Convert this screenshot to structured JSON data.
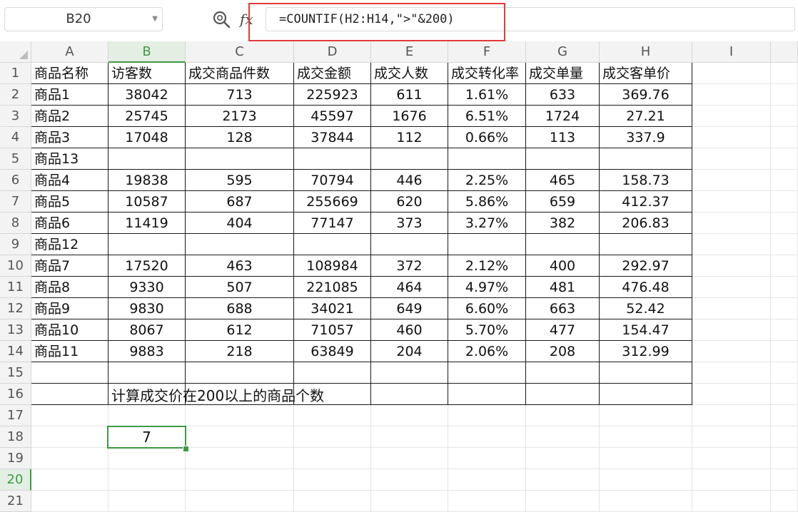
{
  "formula_bar": {
    "name_box": "B20",
    "formula": "=COUNTIF(H2:H14,\">\"&200)",
    "zoom_icon": "zoom-search-icon",
    "fx_icon_label": "fx"
  },
  "sheet": {
    "columns": [
      "A",
      "B",
      "C",
      "D",
      "E",
      "F",
      "G",
      "H",
      "I"
    ],
    "rows": [
      "1",
      "2",
      "3",
      "4",
      "5",
      "6",
      "7",
      "8",
      "9",
      "10",
      "11",
      "12",
      "13",
      "14",
      "15",
      "16",
      "17",
      "18",
      "19",
      "20",
      "21"
    ],
    "selected_column": "B",
    "selected_row": "20",
    "table": {
      "headers": [
        "商品名称",
        "访客数",
        "成交商品件数",
        "成交金额",
        "成交人数",
        "成交转化率",
        "成交单量",
        "成交客单价"
      ],
      "rows": [
        [
          "商品1",
          "38042",
          "713",
          "225923",
          "611",
          "1.61%",
          "633",
          "369.76"
        ],
        [
          "商品2",
          "25745",
          "2173",
          "45597",
          "1676",
          "6.51%",
          "1724",
          "27.21"
        ],
        [
          "商品3",
          "17048",
          "128",
          "37844",
          "112",
          "0.66%",
          "113",
          "337.9"
        ],
        [
          "商品13",
          "",
          "",
          "",
          "",
          "",
          "",
          ""
        ],
        [
          "商品4",
          "19838",
          "595",
          "70794",
          "446",
          "2.25%",
          "465",
          "158.73"
        ],
        [
          "商品5",
          "10587",
          "687",
          "255669",
          "620",
          "5.86%",
          "659",
          "412.37"
        ],
        [
          "商品6",
          "11419",
          "404",
          "77147",
          "373",
          "3.27%",
          "382",
          "206.83"
        ],
        [
          "商品12",
          "",
          "",
          "",
          "",
          "",
          "",
          ""
        ],
        [
          "商品7",
          "17520",
          "463",
          "108984",
          "372",
          "2.12%",
          "400",
          "292.97"
        ],
        [
          "商品8",
          "9330",
          "507",
          "221085",
          "464",
          "4.97%",
          "481",
          "476.48"
        ],
        [
          "商品9",
          "9830",
          "688",
          "34021",
          "649",
          "6.60%",
          "663",
          "52.42"
        ],
        [
          "商品10",
          "8067",
          "612",
          "71057",
          "460",
          "5.70%",
          "477",
          "154.47"
        ],
        [
          "商品11",
          "9883",
          "218",
          "63849",
          "204",
          "2.06%",
          "208",
          "312.99"
        ],
        [
          "",
          "",
          "",
          "",
          "",
          "",
          "",
          ""
        ],
        [
          "",
          "",
          "",
          "",
          "",
          "",
          "",
          ""
        ]
      ]
    },
    "note": "计算成交价在200以上的商品个数",
    "result": "7"
  },
  "colors": {
    "selection_green": "#3f9a44",
    "highlight_red": "#e23b3b"
  }
}
